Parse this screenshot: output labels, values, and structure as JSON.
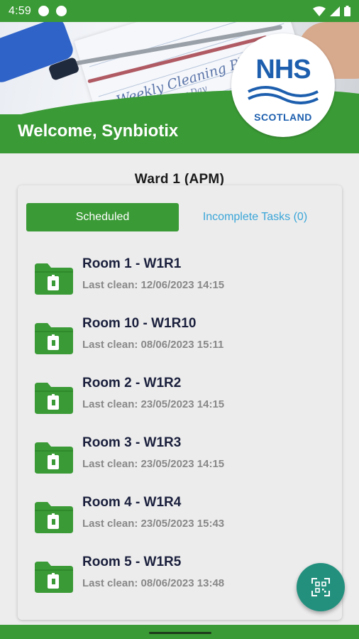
{
  "status_bar": {
    "time": "4:59"
  },
  "header": {
    "banner_title": "Weekly Cleaning Plan",
    "banner_subtitle": "Every Day",
    "logo_main": "NHS",
    "logo_sub": "SCOTLAND",
    "welcome": "Welcome, Synbiotix"
  },
  "ward": {
    "title": "Ward 1 (APM)"
  },
  "tabs": [
    {
      "label": "Scheduled",
      "active": true
    },
    {
      "label": "Incomplete Tasks (0)",
      "active": false
    }
  ],
  "rooms": [
    {
      "name": "Room 1 - W1R1",
      "last_clean": "Last clean: 12/06/2023 14:15"
    },
    {
      "name": "Room 10 - W1R10",
      "last_clean": "Last clean: 08/06/2023 15:11"
    },
    {
      "name": "Room 2 - W1R2",
      "last_clean": "Last clean: 23/05/2023 14:15"
    },
    {
      "name": "Room 3 - W1R3",
      "last_clean": "Last clean: 23/05/2023 14:15"
    },
    {
      "name": "Room 4 - W1R4",
      "last_clean": "Last clean: 23/05/2023 15:43"
    },
    {
      "name": "Room 5 - W1R5",
      "last_clean": "Last clean: 08/06/2023 13:48"
    }
  ],
  "colors": {
    "brand_green": "#3a9a35",
    "fab_teal": "#23907e",
    "tab_link": "#3aa5d8",
    "nhs_blue": "#1d5fae"
  },
  "icons": {
    "room": "folder-clipboard-icon",
    "fab": "qr-scan-icon"
  }
}
